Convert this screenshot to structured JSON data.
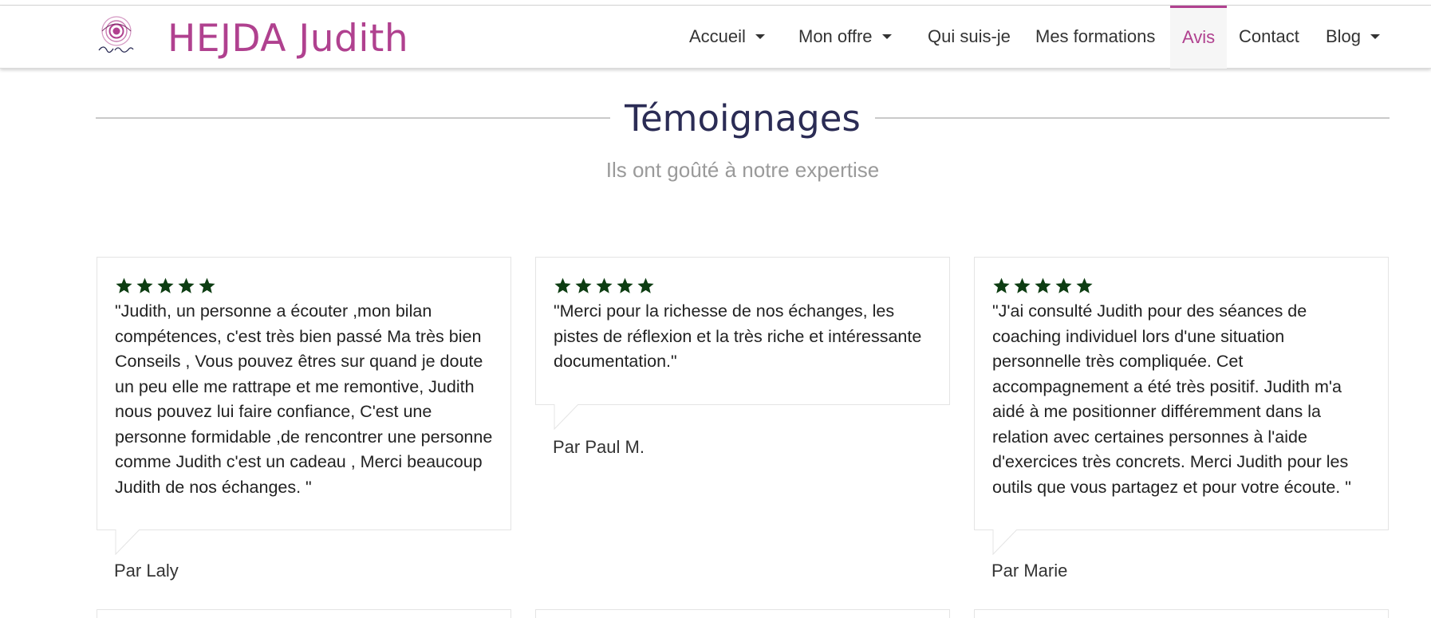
{
  "header": {
    "brand": "HEJDA Judith",
    "logo_icon": "spiral-logo-icon",
    "brand_color": "#b0418f"
  },
  "nav": {
    "items": [
      {
        "label": "Accueil",
        "has_dropdown": true,
        "active": false
      },
      {
        "label": "Mon offre",
        "has_dropdown": true,
        "active": false
      },
      {
        "label": "Qui suis-je",
        "has_dropdown": false,
        "active": false
      },
      {
        "label": "Mes formations",
        "has_dropdown": false,
        "active": false
      },
      {
        "label": "Avis",
        "has_dropdown": false,
        "active": true
      },
      {
        "label": "Contact",
        "has_dropdown": false,
        "active": false
      },
      {
        "label": "Blog",
        "has_dropdown": true,
        "active": false
      }
    ]
  },
  "section": {
    "title": "Témoignages",
    "subtitle": "Ils ont goûté à notre expertise"
  },
  "testimonials": [
    {
      "rating": 5,
      "quote": "\"Judith, un personne a écouter ,mon bilan compétences, c'est très bien passé Ma très bien Conseils , Vous pouvez êtres sur quand je doute un peu elle me rattrape et me remontive, Judith nous pouvez lui faire confiance, C'est une personne formidable ,de rencontrer une personne comme Judith c'est un cadeau , Merci beaucoup Judith de nos échanges. \"",
      "author": "Par Laly"
    },
    {
      "rating": 5,
      "quote": "\"Merci pour la richesse de nos échanges, les pistes de réflexion et la très riche et intéressante documentation.\"",
      "author": "Par Paul M."
    },
    {
      "rating": 5,
      "quote": "\"J'ai consulté Judith pour des séances de coaching individuel lors d'une situation personnelle très compliquée. Cet accompagnement a été très positif. Judith m'a aidé à me positionner différemment dans la relation avec certaines personnes à l'aide d'exercices très concrets. Merci Judith pour les outils que vous partagez et pour votre écoute. \"",
      "author": "Par Marie"
    }
  ],
  "colors": {
    "star": "#0d3d12",
    "title": "#2b2c55",
    "subtitle": "#9a9a9a"
  }
}
